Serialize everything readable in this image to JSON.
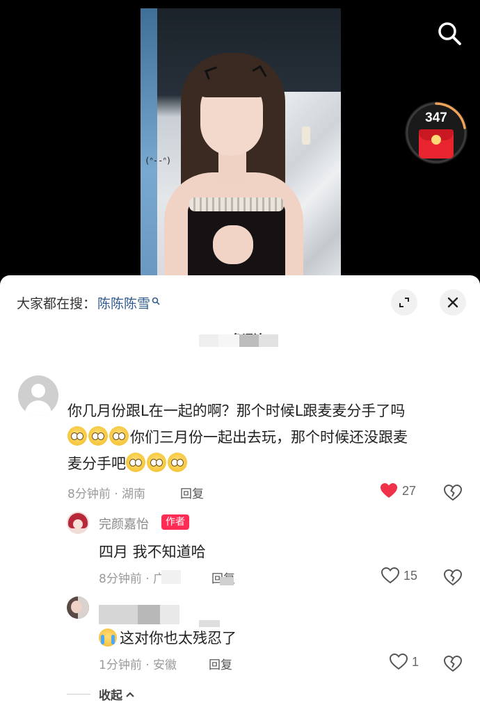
{
  "video": {
    "doodle_text": "(ᐢ--ᐢ)"
  },
  "redpacket": {
    "count": "347",
    "accent": "#e8242f"
  },
  "panel": {
    "search_suggest_prefix": "大家都在搜：",
    "search_suggest_term": "陈陈陈雪",
    "comment_count_title": "65条评论"
  },
  "comments": [
    {
      "text_line1": "你几月份跟L在一起的啊？那个时候L跟麦麦分手了吗",
      "text_line2": "你们三月份一起出去玩，那个时候还没跟麦",
      "text_line3": "麦分手吧",
      "meta": "8分钟前 · 湖南",
      "reply_label": "回复",
      "likes": "27",
      "liked": true,
      "icon_like": "heart-icon",
      "icon_dislike": "broken-heart-icon"
    }
  ],
  "replies": [
    {
      "author": "完颜嘉怡",
      "badge": "作者",
      "text": "四月 我不知道哈",
      "meta": "8分钟前 · 广东",
      "reply_label": "回复",
      "likes": "15"
    },
    {
      "author": "",
      "text": "这对你也太残忍了",
      "meta": "1分钟前 · 安徽",
      "reply_label": "回复",
      "likes": "1"
    }
  ],
  "collapse_label": "收起",
  "colors": {
    "accent_red": "#fe2c55",
    "link_blue": "#2f5b8f",
    "like_red": "#f0314a"
  }
}
